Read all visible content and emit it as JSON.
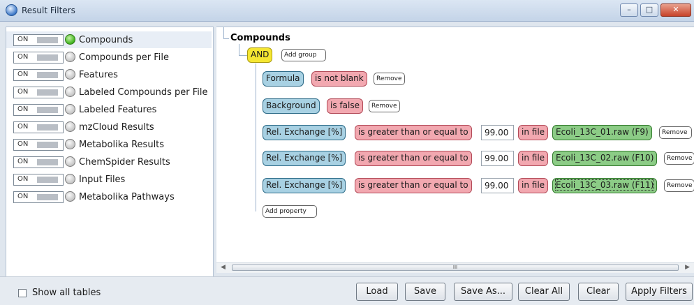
{
  "window": {
    "title": "Result Filters",
    "controls": {
      "minimize": "–",
      "maximize": "□",
      "close": "✕"
    }
  },
  "filters": [
    {
      "label": "Compounds",
      "toggle": "ON",
      "active": true
    },
    {
      "label": "Compounds per File",
      "toggle": "ON",
      "active": false
    },
    {
      "label": "Features",
      "toggle": "ON",
      "active": false
    },
    {
      "label": "Labeled Compounds per File",
      "toggle": "ON",
      "active": false
    },
    {
      "label": "Labeled Features",
      "toggle": "ON",
      "active": false
    },
    {
      "label": "mzCloud Results",
      "toggle": "ON",
      "active": false
    },
    {
      "label": "Metabolika Results",
      "toggle": "ON",
      "active": false
    },
    {
      "label": "ChemSpider Results",
      "toggle": "ON",
      "active": false
    },
    {
      "label": "Input Files",
      "toggle": "ON",
      "active": false
    },
    {
      "label": "Metabolika Pathways",
      "toggle": "ON",
      "active": false
    }
  ],
  "editor": {
    "group_title": "Compounds",
    "logic": "AND",
    "add_group": "Add group",
    "add_property": "Add property",
    "conditions": [
      {
        "property": "Formula",
        "operator": "is not blank",
        "remove": "Remove"
      },
      {
        "property": "Background",
        "operator": "is false",
        "remove": "Remove"
      },
      {
        "property": "Rel. Exchange [%]",
        "operator": "is greater than or equal to",
        "value": "99.00",
        "in_file": "in file",
        "file": "Ecoli_13C_01.raw (F9)",
        "remove": "Remove"
      },
      {
        "property": "Rel. Exchange [%]",
        "operator": "is greater than or equal to",
        "value": "99.00",
        "in_file": "in file",
        "file": "Ecoli_13C_02.raw (F10)",
        "remove": "Remove"
      },
      {
        "property": "Rel. Exchange [%]",
        "operator": "is greater than or equal to",
        "value": "99.00",
        "in_file": "in file",
        "file": "Ecoli_13C_03.raw (F11)",
        "remove": "Remove"
      }
    ]
  },
  "scrollbar": {
    "grip": "III"
  },
  "footer": {
    "show_all_tables": "Show all tables",
    "buttons": {
      "load": "Load",
      "save": "Save",
      "save_as": "Save As...",
      "clear_all": "Clear All",
      "clear": "Clear",
      "apply": "Apply Filters"
    }
  }
}
